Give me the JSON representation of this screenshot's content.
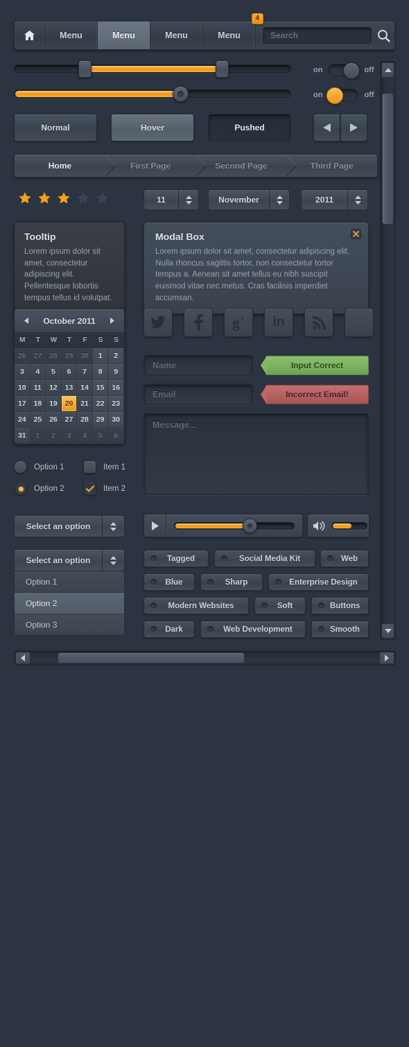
{
  "topnav": {
    "home_icon": "home-icon",
    "items": [
      {
        "label": "Menu",
        "state": "normal"
      },
      {
        "label": "Menu",
        "state": "active"
      },
      {
        "label": "Menu",
        "state": "normal"
      },
      {
        "label": "Menu",
        "state": "normal",
        "badge": "4"
      }
    ],
    "search_placeholder": "Search",
    "search_icon": "search-icon"
  },
  "sliders": {
    "range": {
      "start_pct": 26,
      "end_pct": 74
    },
    "single": {
      "value_pct": 60
    }
  },
  "toggles": [
    {
      "on_label": "on",
      "off_label": "off",
      "state": "off"
    },
    {
      "on_label": "on",
      "off_label": "off",
      "state": "on"
    }
  ],
  "buttons": {
    "normal": "Normal",
    "hover": "Hover",
    "pushed": "Pushed",
    "prev_icon": "arrow-left-icon",
    "next_icon": "arrow-right-icon"
  },
  "breadcrumb": [
    "Home",
    "First Page",
    "Second Page",
    "Third Page"
  ],
  "rating": {
    "filled": 3,
    "total": 5
  },
  "spinners": [
    {
      "value": "11"
    },
    {
      "value": "November"
    },
    {
      "value": "2011"
    }
  ],
  "tooltip": {
    "title": "Tooltip",
    "body": "Lorem ipsum dolor sit amet, consectetur adipiscing elit. Pellentesque lobortis tempus tellus id volutpat."
  },
  "modal": {
    "title": "Modal Box",
    "body": "Lorem ipsum dolor sit amet, consectetur adipiscing elit. Nulla rhoncus sagittis tortor, non consectetur tortor tempus a. Aenean sit amet tellus eu nibh suscipit euismod vitae nec metus. Cras facilisis imperdiet accumsan.",
    "close_icon": "close-icon"
  },
  "calendar": {
    "month": "October 2011",
    "prev_icon": "chevron-left-icon",
    "next_icon": "chevron-right-icon",
    "dow": [
      "M",
      "T",
      "W",
      "T",
      "F",
      "S",
      "S"
    ],
    "weeks": [
      [
        {
          "d": "26",
          "t": "mute"
        },
        {
          "d": "27",
          "t": "mute"
        },
        {
          "d": "28",
          "t": "mute"
        },
        {
          "d": "29",
          "t": "mute"
        },
        {
          "d": "30",
          "t": "mute"
        },
        {
          "d": "1",
          "t": "we"
        },
        {
          "d": "2",
          "t": "we"
        }
      ],
      [
        {
          "d": "3",
          "t": ""
        },
        {
          "d": "4",
          "t": ""
        },
        {
          "d": "5",
          "t": ""
        },
        {
          "d": "6",
          "t": ""
        },
        {
          "d": "7",
          "t": ""
        },
        {
          "d": "8",
          "t": "we"
        },
        {
          "d": "9",
          "t": "we"
        }
      ],
      [
        {
          "d": "10",
          "t": ""
        },
        {
          "d": "11",
          "t": ""
        },
        {
          "d": "12",
          "t": ""
        },
        {
          "d": "13",
          "t": ""
        },
        {
          "d": "14",
          "t": ""
        },
        {
          "d": "15",
          "t": "we"
        },
        {
          "d": "16",
          "t": "we"
        }
      ],
      [
        {
          "d": "17",
          "t": ""
        },
        {
          "d": "18",
          "t": ""
        },
        {
          "d": "19",
          "t": ""
        },
        {
          "d": "20",
          "t": "sel"
        },
        {
          "d": "21",
          "t": ""
        },
        {
          "d": "22",
          "t": "we"
        },
        {
          "d": "23",
          "t": "we"
        }
      ],
      [
        {
          "d": "24",
          "t": ""
        },
        {
          "d": "25",
          "t": ""
        },
        {
          "d": "26",
          "t": ""
        },
        {
          "d": "27",
          "t": ""
        },
        {
          "d": "28",
          "t": ""
        },
        {
          "d": "29",
          "t": "we"
        },
        {
          "d": "30",
          "t": "we"
        }
      ],
      [
        {
          "d": "31",
          "t": ""
        },
        {
          "d": "1",
          "t": "mute"
        },
        {
          "d": "2",
          "t": "mute"
        },
        {
          "d": "3",
          "t": "mute"
        },
        {
          "d": "4",
          "t": "mute"
        },
        {
          "d": "5",
          "t": "mute"
        },
        {
          "d": "6",
          "t": "mute"
        }
      ]
    ]
  },
  "options": {
    "radio1": "Option 1",
    "radio2": "Option 2",
    "check1": "Item 1",
    "check2": "Item 2"
  },
  "select_closed": {
    "label": "Select an option"
  },
  "select_open": {
    "label": "Select an option",
    "options": [
      "Option 1",
      "Option 2",
      "Option 3"
    ],
    "highlighted": "Option 2"
  },
  "social": [
    {
      "name": "twitter-icon",
      "glyph": "t"
    },
    {
      "name": "facebook-icon",
      "glyph": "f"
    },
    {
      "name": "googleplus-icon",
      "glyph": "g+"
    },
    {
      "name": "linkedin-icon",
      "glyph": "in"
    },
    {
      "name": "rss-icon",
      "glyph": "rss"
    },
    {
      "name": "blank-icon",
      "glyph": ""
    }
  ],
  "form": {
    "name_placeholder": "Name",
    "email_placeholder": "Email",
    "message_placeholder": "Message...",
    "success_label": "Input Correct",
    "error_label": "Incorrect Email!"
  },
  "player": {
    "play_icon": "play-icon",
    "progress_pct": 66,
    "volume_icon": "speaker-icon",
    "volume_pct": 55
  },
  "tags": [
    [
      {
        "label": "Tagged",
        "w": 94
      },
      {
        "label": "Social Media Kit",
        "w": 146
      },
      {
        "label": "Web",
        "w": 70
      }
    ],
    [
      {
        "label": "Blue",
        "w": 74
      },
      {
        "label": "Sharp",
        "w": 90
      },
      {
        "label": "Enterprise Design",
        "w": 155
      }
    ],
    [
      {
        "label": "Modern Websites",
        "w": 152
      },
      {
        "label": "Soft",
        "w": 74
      },
      {
        "label": "Buttons",
        "w": 98
      }
    ],
    [
      {
        "label": "Dark",
        "w": 74
      },
      {
        "label": "Web Development",
        "w": 157
      },
      {
        "label": "Smooth",
        "w": 95
      }
    ]
  ],
  "scrollbars": {
    "up_icon": "triangle-up-icon",
    "down_icon": "triangle-down-icon",
    "left_icon": "triangle-left-icon",
    "right_icon": "triangle-right-icon"
  },
  "colors": {
    "background": "#2b3440",
    "accent_orange": "#f5a11c",
    "success_green": "#7fb35e",
    "error_red": "#b46060",
    "panel": "#3d4652",
    "sunken": "#2a313c"
  }
}
